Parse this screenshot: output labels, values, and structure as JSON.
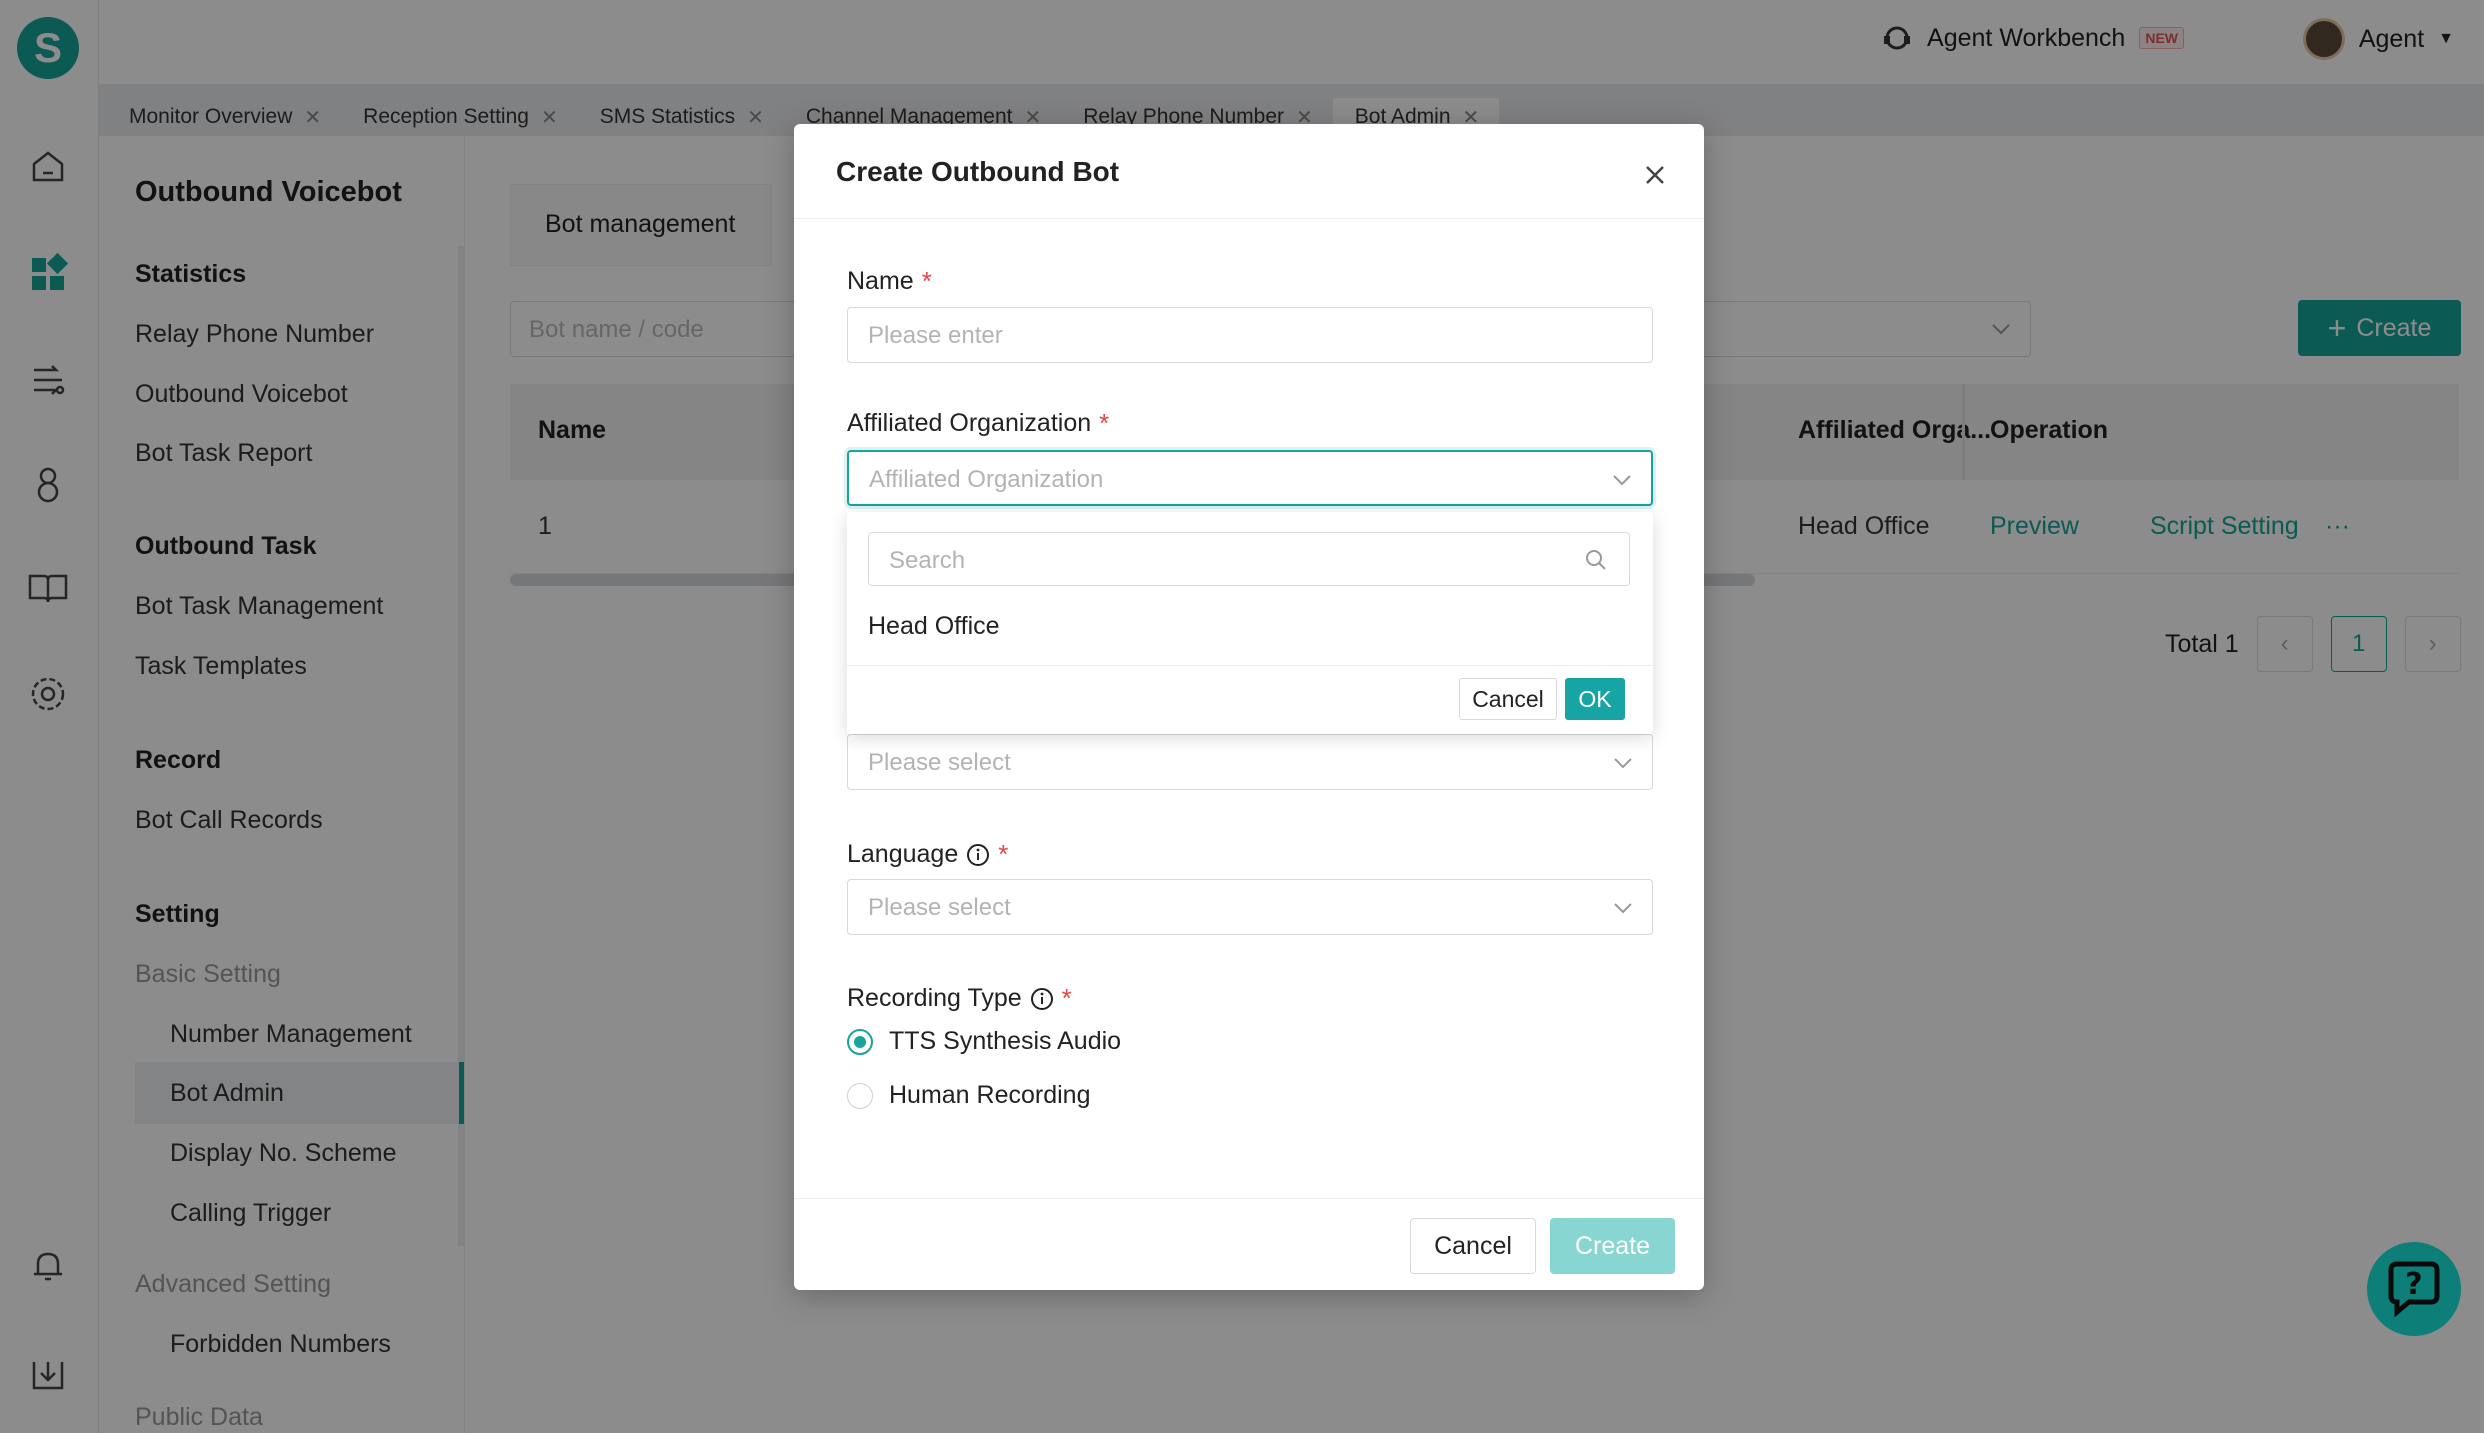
{
  "colors": {
    "accent": "#17a49a",
    "required": "#e54545",
    "new_badge": "#e45454"
  },
  "logo": "S",
  "rail_icons": [
    "home-icon",
    "dashboard-icon",
    "routing-icon",
    "contacts-icon",
    "book-icon",
    "gear-icon",
    "bell-icon",
    "download-icon"
  ],
  "topbar": {
    "workbench": "Agent Workbench",
    "new_badge": "NEW",
    "agent": "Agent"
  },
  "tabs": [
    {
      "label": "Monitor Overview"
    },
    {
      "label": "Reception Setting"
    },
    {
      "label": "SMS Statistics"
    },
    {
      "label": "Channel Management"
    },
    {
      "label": "Relay Phone Number"
    },
    {
      "label": "Bot Admin"
    }
  ],
  "menu": {
    "title": "Outbound Voicebot",
    "statistics": {
      "heading": "Statistics",
      "items": [
        "Relay Phone Number",
        "Outbound Voicebot",
        "Bot Task Report"
      ]
    },
    "outbound_task": {
      "heading": "Outbound Task",
      "items": [
        "Bot Task Management",
        "Task Templates"
      ]
    },
    "record": {
      "heading": "Record",
      "items": [
        "Bot Call Records"
      ]
    },
    "setting": {
      "heading": "Setting",
      "basic": "Basic Setting",
      "basic_items": [
        "Number Management",
        "Bot Admin",
        "Display No. Scheme",
        "Calling Trigger"
      ],
      "advanced": "Advanced Setting",
      "advanced_items": [
        "Forbidden Numbers"
      ],
      "public": "Public Data"
    }
  },
  "main": {
    "tab": "Bot management",
    "search_placeholder": "Bot name / code",
    "create": "Create",
    "columns": {
      "name": "Name",
      "org": "Affiliated Orga...",
      "operation": "Operation"
    },
    "rows": [
      {
        "name": "1",
        "org": "Head Office",
        "ops": [
          "Preview",
          "Script Setting",
          "···"
        ]
      }
    ],
    "total": "Total 1",
    "page": "1"
  },
  "modal": {
    "title": "Create Outbound Bot",
    "name_label": "Name",
    "name_placeholder": "Please enter",
    "org_label": "Affiliated Organization",
    "org_placeholder": "Affiliated Organization",
    "dropdown": {
      "search_placeholder": "Search",
      "option": "Head Office",
      "cancel": "Cancel",
      "ok": "OK"
    },
    "hidden_select_placeholder": "Please select",
    "language_label": "Language",
    "language_placeholder": "Please select",
    "recording_label": "Recording Type",
    "recording_options": [
      "TTS Synthesis Audio",
      "Human Recording"
    ],
    "recording_selected": "TTS Synthesis Audio",
    "required_mark": "*",
    "cancel": "Cancel",
    "create": "Create"
  }
}
